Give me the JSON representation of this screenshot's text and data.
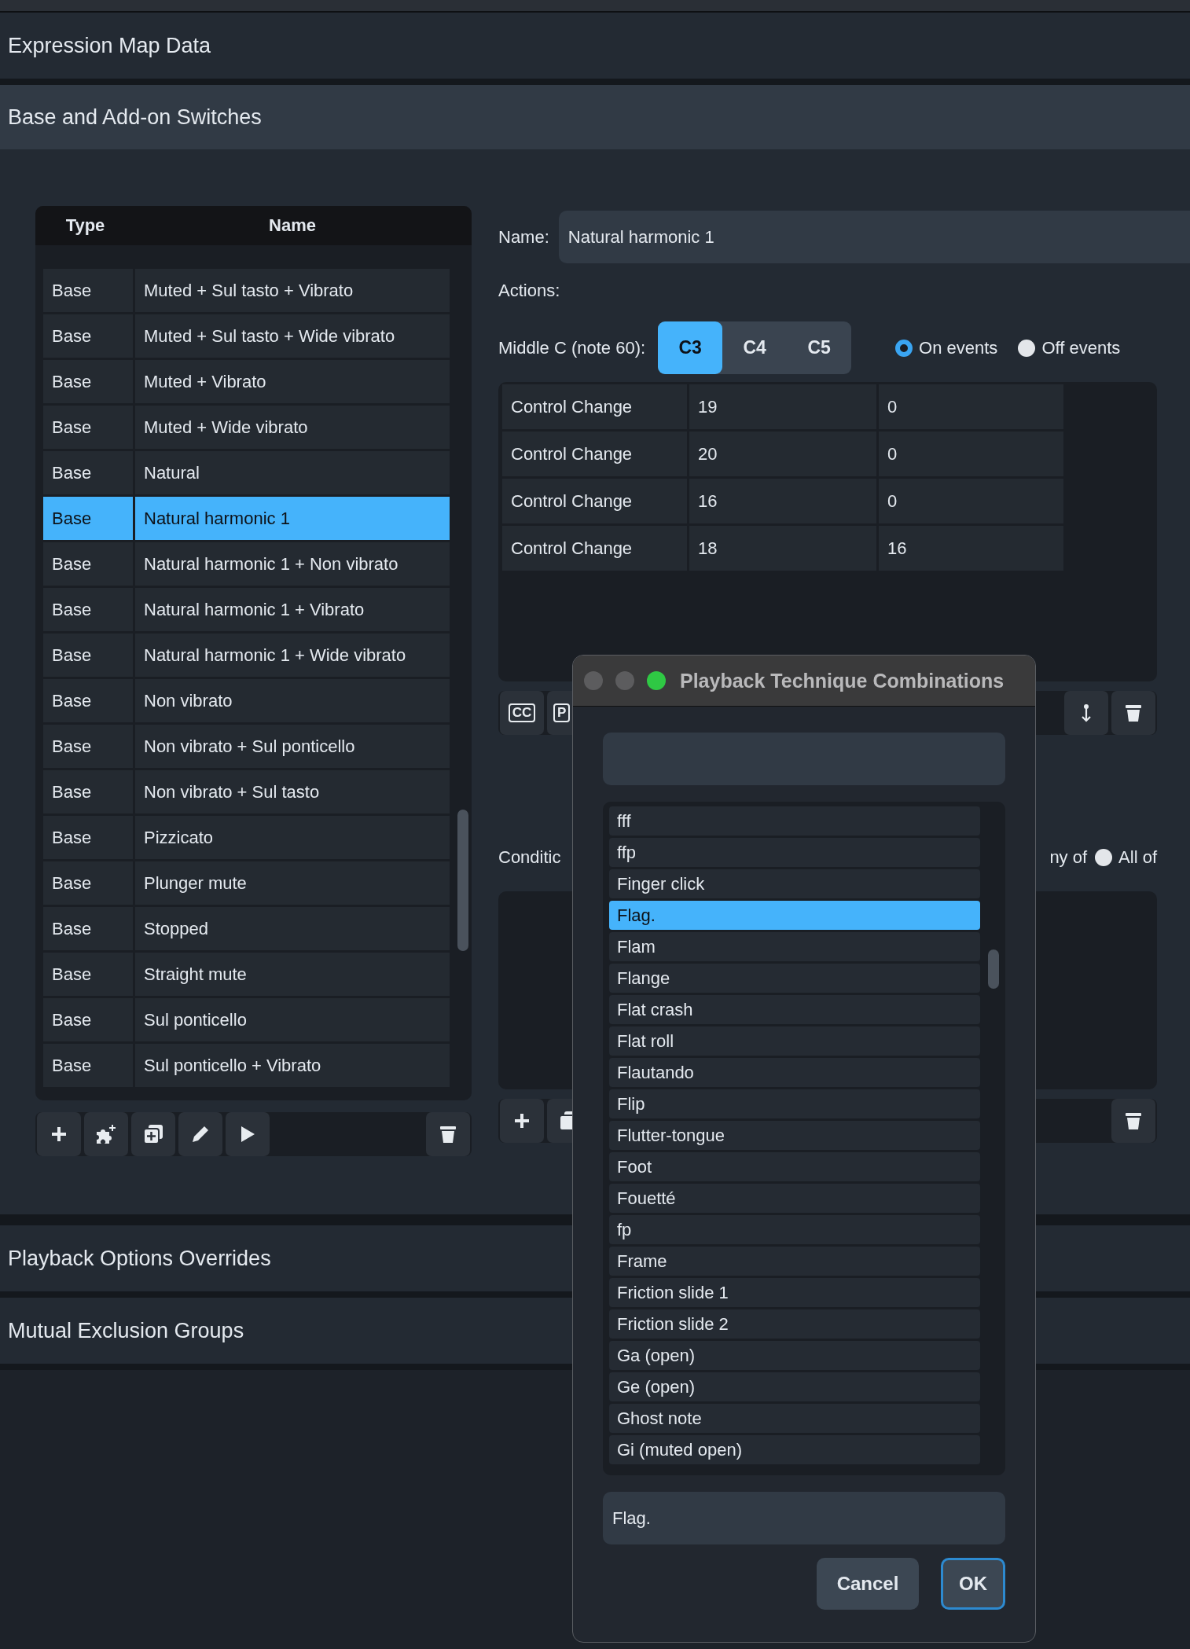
{
  "sections": [
    {
      "title": "Expression Map Data"
    },
    {
      "title": "Base and Add-on Switches"
    }
  ],
  "switches_table": {
    "columns": [
      "Type",
      "Name"
    ],
    "rows": [
      {
        "type": "Base",
        "name": "Muted + Sul tasto + Vibrato",
        "selected": false
      },
      {
        "type": "Base",
        "name": "Muted + Sul tasto + Wide vibrato",
        "selected": false
      },
      {
        "type": "Base",
        "name": "Muted + Vibrato",
        "selected": false
      },
      {
        "type": "Base",
        "name": "Muted + Wide vibrato",
        "selected": false
      },
      {
        "type": "Base",
        "name": "Natural",
        "selected": false
      },
      {
        "type": "Base",
        "name": "Natural harmonic 1",
        "selected": true
      },
      {
        "type": "Base",
        "name": "Natural harmonic 1 + Non vibrato",
        "selected": false
      },
      {
        "type": "Base",
        "name": "Natural harmonic 1 + Vibrato",
        "selected": false
      },
      {
        "type": "Base",
        "name": "Natural harmonic 1 + Wide vibrato",
        "selected": false
      },
      {
        "type": "Base",
        "name": "Non vibrato",
        "selected": false
      },
      {
        "type": "Base",
        "name": "Non vibrato + Sul ponticello",
        "selected": false
      },
      {
        "type": "Base",
        "name": "Non vibrato + Sul tasto",
        "selected": false
      },
      {
        "type": "Base",
        "name": "Pizzicato",
        "selected": false
      },
      {
        "type": "Base",
        "name": "Plunger mute",
        "selected": false
      },
      {
        "type": "Base",
        "name": "Stopped",
        "selected": false
      },
      {
        "type": "Base",
        "name": "Straight mute",
        "selected": false
      },
      {
        "type": "Base",
        "name": "Sul ponticello",
        "selected": false
      },
      {
        "type": "Base",
        "name": "Sul ponticello + Vibrato",
        "selected": false
      }
    ]
  },
  "name_field": {
    "label": "Name:",
    "value": "Natural harmonic 1"
  },
  "actions_label": "Actions:",
  "middle_c": {
    "label": "Middle C (note 60):",
    "options": [
      {
        "label": "C3",
        "selected": true
      },
      {
        "label": "C4",
        "selected": false
      },
      {
        "label": "C5",
        "selected": false
      }
    ]
  },
  "event_filter": [
    {
      "label": "On events",
      "selected": true
    },
    {
      "label": "Off events",
      "selected": false
    }
  ],
  "actions_table": {
    "rows": [
      [
        "Control Change",
        "19",
        "0"
      ],
      [
        "Control Change",
        "20",
        "0"
      ],
      [
        "Control Change",
        "16",
        "0"
      ],
      [
        "Control Change",
        "18",
        "16"
      ]
    ]
  },
  "actions_toolbar": {
    "cc_label": "CC",
    "p_label": "P"
  },
  "conditions": {
    "label": "Conditic",
    "match_label": "ny of",
    "options": [
      {
        "label": "All of",
        "selected": false
      }
    ]
  },
  "bottom_sections": [
    {
      "title": "Playback Options Overrides"
    },
    {
      "title": "Mutual Exclusion Groups"
    }
  ],
  "dialog": {
    "title": "Playback Technique Combinations",
    "items": [
      {
        "label": "fff",
        "selected": false
      },
      {
        "label": "ffp",
        "selected": false
      },
      {
        "label": "Finger click",
        "selected": false
      },
      {
        "label": "Flag.",
        "selected": true
      },
      {
        "label": "Flam",
        "selected": false
      },
      {
        "label": "Flange",
        "selected": false
      },
      {
        "label": "Flat crash",
        "selected": false
      },
      {
        "label": "Flat roll",
        "selected": false
      },
      {
        "label": "Flautando",
        "selected": false
      },
      {
        "label": "Flip",
        "selected": false
      },
      {
        "label": "Flutter-tongue",
        "selected": false
      },
      {
        "label": "Foot",
        "selected": false
      },
      {
        "label": "Fouetté",
        "selected": false
      },
      {
        "label": "fp",
        "selected": false
      },
      {
        "label": "Frame",
        "selected": false
      },
      {
        "label": "Friction slide 1",
        "selected": false
      },
      {
        "label": "Friction slide 2",
        "selected": false
      },
      {
        "label": "Ga (open)",
        "selected": false
      },
      {
        "label": "Ge (open)",
        "selected": false
      },
      {
        "label": "Ghost note",
        "selected": false
      },
      {
        "label": "Gi (muted open)",
        "selected": false
      }
    ],
    "selection": "Flag.",
    "buttons": [
      {
        "label": "Cancel",
        "kind": "secondary"
      },
      {
        "label": "OK",
        "kind": "default"
      }
    ]
  }
}
